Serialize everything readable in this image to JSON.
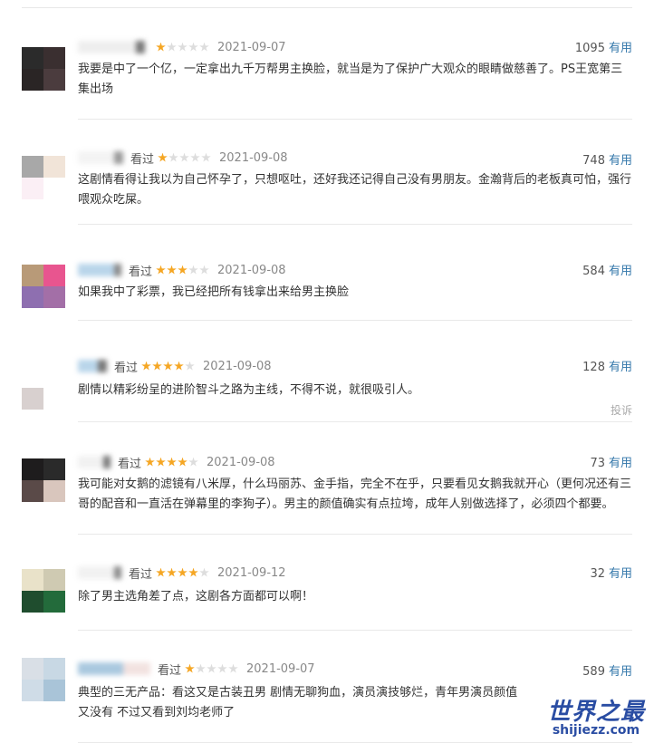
{
  "reviews": [
    {
      "status": "",
      "rating": 1,
      "date": "2021-09-07",
      "useful_count": "1095",
      "useful_label": "有用",
      "content": "我要是中了一个亿，一定拿出九千万帮男主换脸，就当是为了保护广大观众的眼睛做慈善了。PS王宽第三集出场",
      "avatar": [
        "#2b2b2b",
        "#3a2f30",
        "#2a2525",
        "#4b3c3e"
      ]
    },
    {
      "status": "看过",
      "rating": 1,
      "date": "2021-09-08",
      "useful_count": "748",
      "useful_label": "有用",
      "content": "这剧情看得让我以为自己怀孕了，只想呕吐，还好我还记得自己没有男朋友。金瀚背后的老板真可怕，强行喂观众吃屎。",
      "avatar": [
        "#a8a8a8",
        "#f1e4d8",
        "#fbeff5",
        "#ffffff"
      ]
    },
    {
      "status": "看过",
      "rating": 3,
      "date": "2021-09-08",
      "useful_count": "584",
      "useful_label": "有用",
      "content": "如果我中了彩票，我已经把所有钱拿出来给男主换脸",
      "avatar": [
        "#b89a78",
        "#e8558f",
        "#8e6fb0",
        "#a36fa7"
      ]
    },
    {
      "status": "看过",
      "rating": 4,
      "date": "2021-09-08",
      "useful_count": "128",
      "useful_label": "有用",
      "content": "剧情以精彩纷呈的进阶智斗之路为主线，不得不说，就很吸引人。",
      "report": "投诉",
      "avatar": [
        "#ffffff",
        "#ffffff",
        "#d8d0cf",
        "#ffffff"
      ]
    },
    {
      "status": "看过",
      "rating": 4,
      "date": "2021-09-08",
      "useful_count": "73",
      "useful_label": "有用",
      "content": "我可能对女鹅的滤镜有八米厚，什么玛丽苏、金手指，完全不在乎，只要看见女鹅我就开心（更何况还有三哥的配音和一直活在弹幕里的李狗子）。男主的颜值确实有点拉垮，成年人别做选择了，必须四个都要。",
      "avatar": [
        "#1e1c1d",
        "#2a2a2a",
        "#5a4a48",
        "#d9c6bd"
      ]
    },
    {
      "status": "看过",
      "rating": 4,
      "date": "2021-09-12",
      "useful_count": "32",
      "useful_label": "有用",
      "content": "除了男主选角差了点，这剧各方面都可以啊！",
      "avatar": [
        "#e9e2c9",
        "#cfcab2",
        "#1f4d2e",
        "#236b3b"
      ]
    },
    {
      "status": "看过",
      "rating": 1,
      "date": "2021-09-07",
      "useful_count": "589",
      "useful_label": "有用",
      "content": "典型的三无产品：看这又是古装丑男 剧情无聊狗血，演员演技够烂，青年男演员颜值又没有 不过又看到刘均老师了",
      "avatar": [
        "#d9dfe6",
        "#c8d8e4",
        "#cfdce7",
        "#a9c4d8"
      ]
    }
  ],
  "watermark": {
    "title": "世界之最",
    "url": "shijiezz.com"
  }
}
